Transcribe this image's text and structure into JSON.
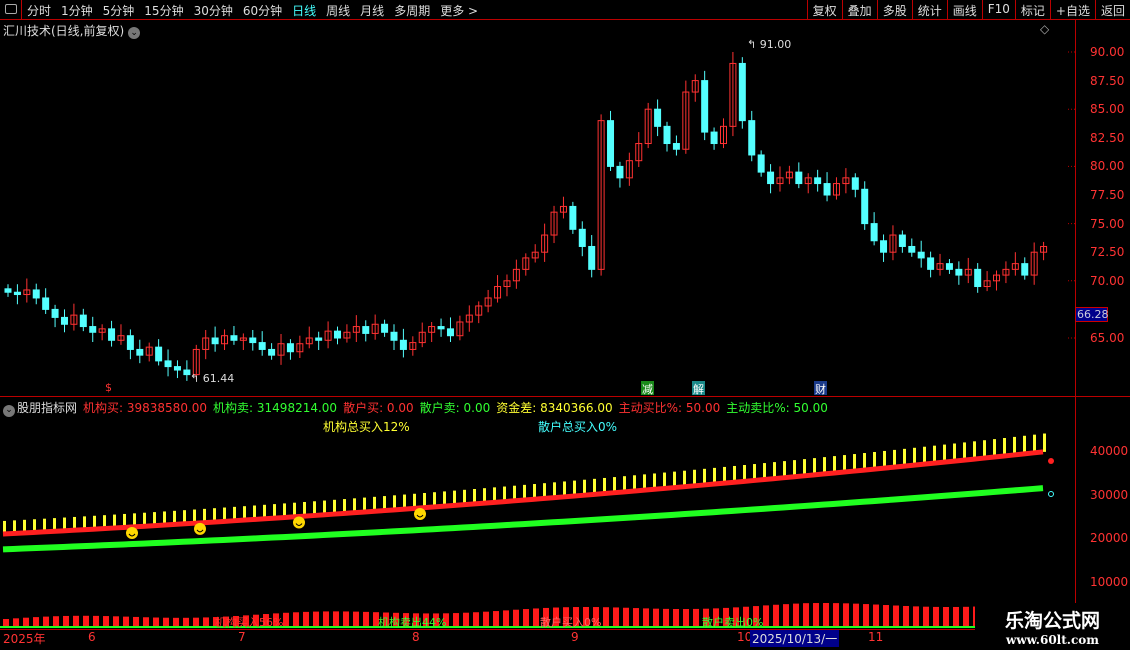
{
  "toolbar": {
    "periods": [
      "分时",
      "1分钟",
      "5分钟",
      "15分钟",
      "30分钟",
      "60分钟",
      "日线",
      "周线",
      "月线",
      "多周期",
      "更多 >"
    ],
    "active": "日线",
    "buttons": [
      "复权",
      "叠加",
      "多股",
      "统计",
      "画线",
      "F10",
      "标记",
      "+自选",
      "返回"
    ]
  },
  "main": {
    "title": "汇川技术(日线,前复权)",
    "high_label": "91.00",
    "low_label": "61.44",
    "current_price": "66.28",
    "y_ticks": [
      "90.00",
      "87.50",
      "85.00",
      "82.50",
      "80.00",
      "77.50",
      "75.00",
      "72.50",
      "70.00",
      "65.00"
    ],
    "tags": [
      {
        "text": "$",
        "color": "#ff3333"
      },
      {
        "text": "减",
        "color": "#1a8a1a"
      },
      {
        "text": "解",
        "color": "#1a8a8a"
      },
      {
        "text": "财",
        "color": "#1a3a8a"
      }
    ]
  },
  "chart_data": {
    "type": "candlestick",
    "ylim": [
      60,
      92
    ],
    "up_color": "#ff3232",
    "down_color": "#54ffff",
    "close": [
      69,
      68.8,
      69.2,
      68.5,
      67.5,
      66.8,
      66.2,
      67,
      66,
      65.5,
      65.8,
      64.8,
      65.2,
      64,
      63.5,
      64.2,
      63,
      62.5,
      62.2,
      61.8,
      64,
      65,
      64.5,
      65.2,
      64.8,
      65,
      64.6,
      64,
      63.5,
      64.5,
      63.8,
      64.5,
      65,
      64.8,
      65.6,
      65,
      65.5,
      66,
      65.4,
      66.2,
      65.5,
      64.8,
      64,
      64.6,
      65.5,
      66,
      65.8,
      65.2,
      66.4,
      67,
      67.8,
      68.5,
      69.5,
      70,
      71,
      72,
      72.5,
      74,
      76,
      76.5,
      74.5,
      73,
      71,
      84,
      80,
      79,
      80.5,
      82,
      85,
      83.5,
      82,
      81.5,
      86.5,
      87.5,
      83,
      82,
      83.5,
      89,
      84,
      81,
      79.5,
      78.5,
      79,
      79.5,
      78.5,
      79,
      78.5,
      77.5,
      78.5,
      79,
      78,
      75,
      73.5,
      72.5,
      74,
      73,
      72.5,
      72,
      71,
      71.5,
      71,
      70.5,
      71,
      69.5,
      70,
      70.5,
      71,
      71.5,
      70.5,
      72.5,
      73
    ]
  },
  "indicator": {
    "name": "股朋指标网",
    "values": [
      {
        "label": "机构买: 39838580.00",
        "color": "#ff3232"
      },
      {
        "label": "机构卖: 31498214.00",
        "color": "#32ff32"
      },
      {
        "label": "散户买: 0.00",
        "color": "#ff3232"
      },
      {
        "label": "散户卖: 0.00",
        "color": "#32ff32"
      },
      {
        "label": "资金差: 8340366.00",
        "color": "#ffff32"
      },
      {
        "label": "主动买比%: 50.00",
        "color": "#ff3232"
      },
      {
        "label": "主动卖比%: 50.00",
        "color": "#32ff32"
      }
    ],
    "inst_total": "机构总买入12%",
    "retail_total": "散户总买入0%",
    "y_ticks": [
      "40000",
      "30000",
      "20000",
      "10000"
    ],
    "bottom_labels": [
      "机构买入56%",
      "机构卖出44%",
      "散户买入0%",
      "散户卖出0%"
    ],
    "series": {
      "yellow_start": 24000,
      "yellow_end": 44000,
      "red_start": 21000,
      "red_end": 39800,
      "green_start": 17500,
      "green_end": 31500
    }
  },
  "dates": [
    "2025年",
    "6",
    "7",
    "8",
    "9",
    "10",
    "2025/10/13/一",
    "11"
  ],
  "watermark": {
    "name": "乐淘公式网",
    "url": "www.60lt.com"
  }
}
